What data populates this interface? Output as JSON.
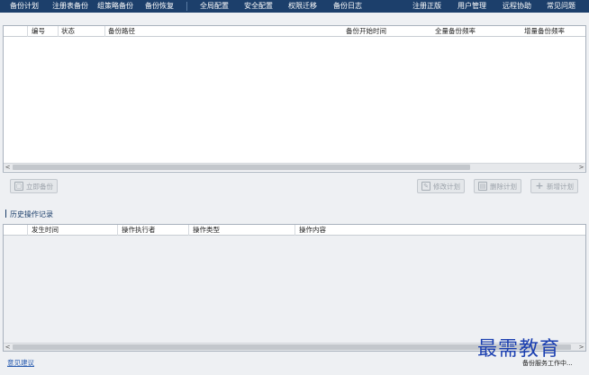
{
  "nav": {
    "backup_plan": "备份计划",
    "registry_backup": "注册表备份",
    "group_policy_backup": "组策略备份",
    "backup_restore": "备份恢复",
    "global_config": "全局配置",
    "security_config": "安全配置",
    "permission_migration": "权限迁移",
    "backup_log": "备份日志",
    "register_license": "注册正版",
    "user_management": "用户管理",
    "remote_assist": "远程协助",
    "faq": "常见问题"
  },
  "plan_table": {
    "columns": [
      "编号",
      "状态",
      "备份路径",
      "备份开始时间",
      "全量备份频率",
      "增量备份频率"
    ],
    "rows": []
  },
  "buttons": {
    "backup_now": "立即备份",
    "edit_plan": "修改计划",
    "delete_plan": "删除计划",
    "add_plan": "新增计划"
  },
  "history": {
    "title": "历史操作记录",
    "columns": [
      "发生时间",
      "操作执行者",
      "操作类型",
      "操作内容"
    ],
    "rows": []
  },
  "footer": {
    "feedback_link": "意见建议",
    "status": "备份服务工作中..."
  },
  "watermark": "最需教育"
}
